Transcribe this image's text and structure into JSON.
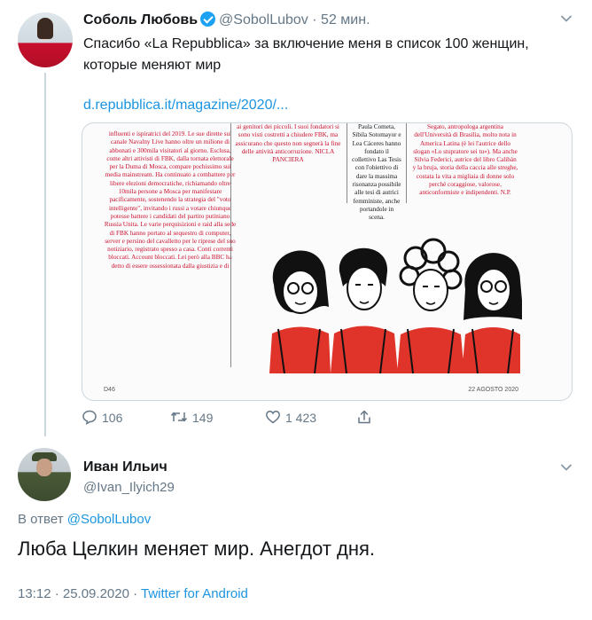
{
  "tweet": {
    "author_name": "Соболь Любовь",
    "handle": "@SobolLubov",
    "separator": "·",
    "time_ago": "52 мин.",
    "text_line1": "Спасибо «La Repubblica» за включение меня в список 100 женщин,",
    "text_line2": "которые меняют мир",
    "link": "d.repubblica.it/magazine/2020/...",
    "media": {
      "col1": "influenti e ispiratrici del 2019. Le sue dirette sul canale Navalny Live hanno oltre un milione di abbonati e 300mila visitatori al giorno. Esclusa, come altri attivisti di FBK, dalla tornata elettorale per la Duma di Mosca, compare pochissimo sui media mainstream. Ha continuato a combattere per libere elezioni democratiche, richiamando oltre 10mila persone a Mosca per manifestare pacificamente, sostenendo la strategia del \"voto intelligente\", invitando i russi a votare chiunque potesse battere i candidati del partito putiniano Russia Unita. Le varie perquisizioni e raid alla sede di FBK hanno portato al sequestro di computer, server e persino del cavalletto per le riprese del suo notiziario, registrato spesso a casa. Conti correnti bloccati. Account bloccati. Lei però alla BBC ha detto di essere ossessionata dalla giustizia e di",
      "col2": "ai genitori dei piccoli. I suoi fondatori si sono visti costretti a chiudere FBK, ma assicurano che questo non segnerà la fine delle attività anticorruzione. NICLA PANCIERA",
      "col3": "Paula Cometa, Sibila Sotomayor e Lea Cáceres hanno fondato il collettivo Las Tesis con l'obiettivo di dare la massima risonanza possibile alle tesi di autrici femministe, anche portandole in scena.",
      "col4": "Segato, antropologa argentina dell'Università di Brasilia, molto nota in America Latina (è lei l'autrice dello slogan «Lo stupratore sei tu»). Ma anche Silvia Federici, autrice del libro Calibán y la bruja, storia della caccia alle streghe, costata la vita a migliaia di donne solo perché coraggiose, valorose, anticonformiste e indipendenti. N.P.",
      "page_left": "D46",
      "page_right": "22 AGOSTO 2020"
    },
    "stats": {
      "replies": "106",
      "retweets": "149",
      "likes": "1 423"
    }
  },
  "reply": {
    "author_name": "Иван Ильич",
    "handle": "@Ivan_Ilyich29",
    "in_reply_prefix": "В ответ",
    "in_reply_to": "@SobolLubov",
    "text": "Люба Целкин меняет мир. Анегдот дня.",
    "timestamp": "13:12 · 25.09.2020 ·",
    "source": "Twitter for Android"
  },
  "colors": {
    "link": "#1b95e0",
    "muted": "#657786",
    "accent_red": "#c8102e"
  }
}
